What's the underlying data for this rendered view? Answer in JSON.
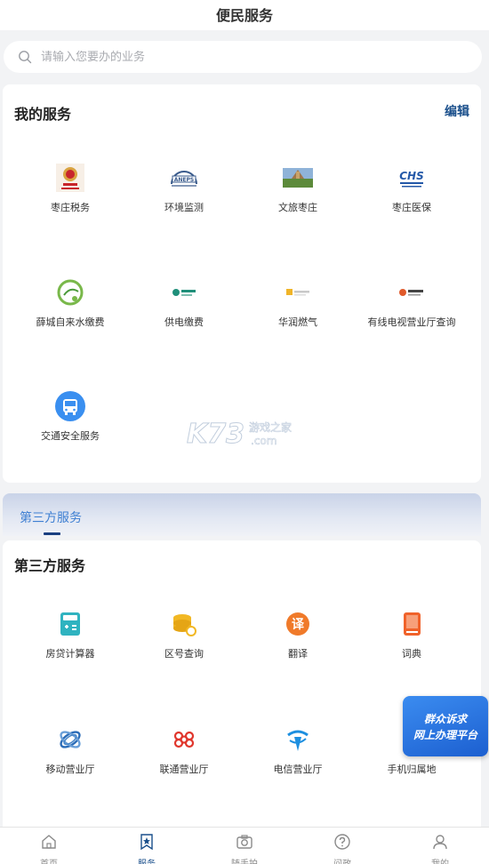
{
  "header": {
    "title": "便民服务"
  },
  "search": {
    "placeholder": "请输入您要办的业务"
  },
  "my_services": {
    "title": "我的服务",
    "edit_label": "编辑",
    "items": [
      {
        "label": "枣庄税务",
        "icon": "tax-emblem-icon"
      },
      {
        "label": "环境监测",
        "icon": "env-monitor-icon"
      },
      {
        "label": "文旅枣庄",
        "icon": "tourism-photo-icon"
      },
      {
        "label": "枣庄医保",
        "icon": "medical-insurance-icon"
      },
      {
        "label": "薛城自来水缴费",
        "icon": "water-bill-icon"
      },
      {
        "label": "供电缴费",
        "icon": "power-bill-icon"
      },
      {
        "label": "华润燃气",
        "icon": "gas-icon"
      },
      {
        "label": "有线电视营业厅查询",
        "icon": "cable-tv-icon"
      },
      {
        "label": "交通安全服务",
        "icon": "bus-icon"
      }
    ]
  },
  "third_party_tab": {
    "label": "第三方服务"
  },
  "third_party": {
    "title": "第三方服务",
    "items": [
      {
        "label": "房贷计算器",
        "icon": "calculator-icon"
      },
      {
        "label": "区号查询",
        "icon": "area-code-icon"
      },
      {
        "label": "翻译",
        "icon": "translate-icon",
        "glyph": "译"
      },
      {
        "label": "词典",
        "icon": "dictionary-icon"
      },
      {
        "label": "移动营业厅",
        "icon": "china-mobile-icon"
      },
      {
        "label": "联通营业厅",
        "icon": "china-unicom-icon"
      },
      {
        "label": "电信营业厅",
        "icon": "china-telecom-icon"
      },
      {
        "label": "手机归属地",
        "icon": "phone-location-icon"
      }
    ]
  },
  "floating_badge": {
    "line1": "群众诉求",
    "line2": "网上办理平台"
  },
  "tabbar": {
    "items": [
      {
        "label": "首页",
        "icon": "home-icon"
      },
      {
        "label": "服务",
        "icon": "star-bookmark-icon"
      },
      {
        "label": "随手拍",
        "icon": "camera-icon"
      },
      {
        "label": "问政",
        "icon": "question-icon"
      },
      {
        "label": "我的",
        "icon": "user-icon"
      }
    ],
    "active_index": 1
  },
  "watermark": {
    "text_main": "K73",
    "text_sub": "游戏之家",
    "text_domain": ".com"
  },
  "colors": {
    "accent": "#1a4f8b",
    "tab_blue": "#3e7fd2",
    "page_bg": "#f2f3f5"
  }
}
